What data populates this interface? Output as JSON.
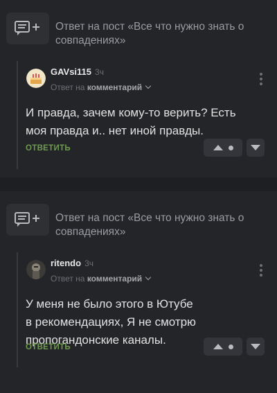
{
  "colors": {
    "background": "#1e1f22",
    "card": "#242529",
    "accent_answer": "#6f9b4f",
    "muted": "#6d6f74"
  },
  "comments": [
    {
      "post_title": "Ответ на пост «Все что нужно знать о совпадениях»",
      "user": "GAVsi115",
      "time": "3ч",
      "reply_prefix": "Ответ на",
      "reply_target": "комментарий",
      "text": "И правда, зачем кому-то верить? Есть\nмоя правда и.. нет иной правды.",
      "answer_label": "ОТВЕТИТЬ",
      "icons": [
        "reply-post-icon",
        "avatar-cake-icon",
        "more-vertical-icon",
        "vote-up-icon",
        "vote-neutral-icon",
        "vote-down-icon"
      ]
    },
    {
      "post_title": "Ответ на пост «Все что нужно знать о совпадениях»",
      "user": "ritendo",
      "time": "3ч",
      "reply_prefix": "Ответ на",
      "reply_target": "комментарий",
      "text": "У меня не было этого в Ютубе\nв рекомендациях, Я не смотрю\nпропогандонские каналы.",
      "answer_label": "ОТВЕТИТЬ",
      "icons": [
        "reply-post-icon",
        "avatar-photo-icon",
        "more-vertical-icon",
        "vote-up-icon",
        "vote-neutral-icon",
        "vote-down-icon"
      ]
    }
  ]
}
